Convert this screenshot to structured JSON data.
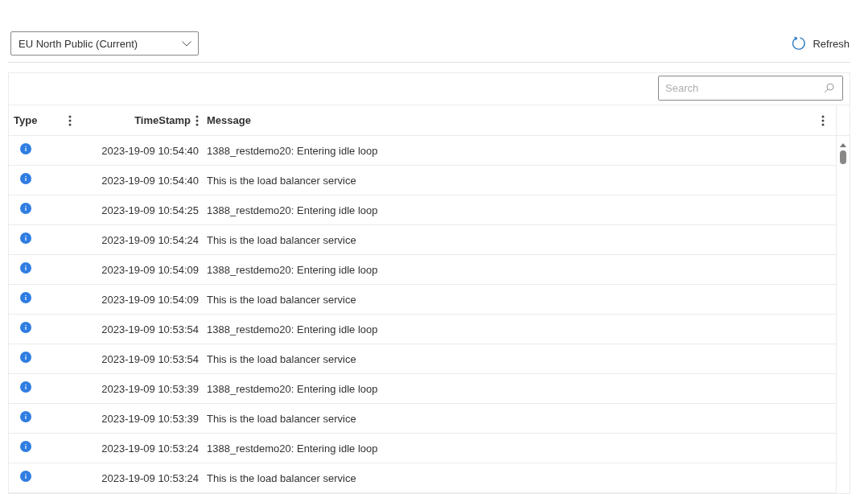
{
  "region_select": {
    "value": "EU North Public (Current)"
  },
  "refresh_button": {
    "label": "Refresh"
  },
  "search": {
    "placeholder": "Search"
  },
  "table": {
    "columns": [
      {
        "label": "Type"
      },
      {
        "label": "TimeStamp"
      },
      {
        "label": "Message"
      }
    ],
    "rows": [
      {
        "kind": "info",
        "timestamp": "2023-19-09 10:54:40",
        "message": "1388_restdemo20: Entering idle loop"
      },
      {
        "kind": "info",
        "timestamp": "2023-19-09 10:54:40",
        "message": "This is the load balancer service"
      },
      {
        "kind": "info",
        "timestamp": "2023-19-09 10:54:25",
        "message": "1388_restdemo20: Entering idle loop"
      },
      {
        "kind": "info",
        "timestamp": "2023-19-09 10:54:24",
        "message": "This is the load balancer service"
      },
      {
        "kind": "info",
        "timestamp": "2023-19-09 10:54:09",
        "message": "1388_restdemo20: Entering idle loop"
      },
      {
        "kind": "info",
        "timestamp": "2023-19-09 10:54:09",
        "message": "This is the load balancer service"
      },
      {
        "kind": "info",
        "timestamp": "2023-19-09 10:53:54",
        "message": "1388_restdemo20: Entering idle loop"
      },
      {
        "kind": "info",
        "timestamp": "2023-19-09 10:53:54",
        "message": "This is the load balancer service"
      },
      {
        "kind": "info",
        "timestamp": "2023-19-09 10:53:39",
        "message": "1388_restdemo20: Entering idle loop"
      },
      {
        "kind": "info",
        "timestamp": "2023-19-09 10:53:39",
        "message": "This is the load balancer service"
      },
      {
        "kind": "info",
        "timestamp": "2023-19-09 10:53:24",
        "message": "1388_restdemo20: Entering idle loop"
      },
      {
        "kind": "info",
        "timestamp": "2023-19-09 10:53:24",
        "message": "This is the load balancer service"
      }
    ]
  }
}
